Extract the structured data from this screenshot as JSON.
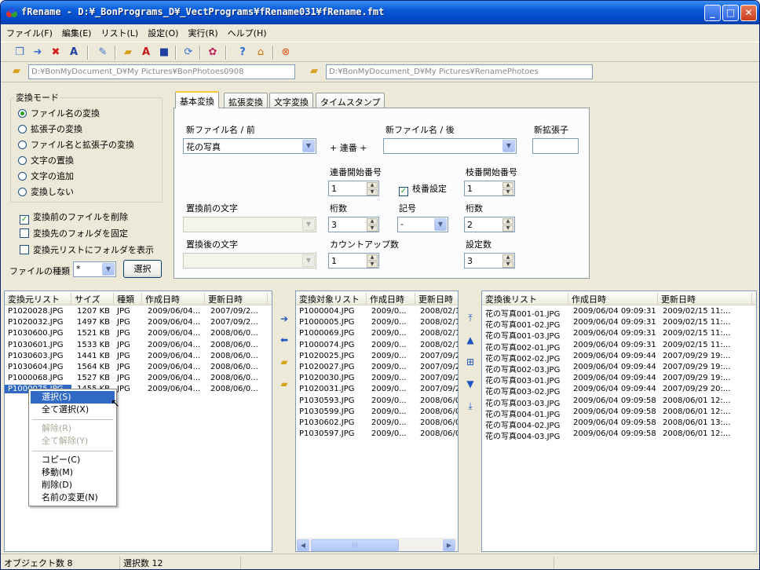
{
  "window": {
    "title": "fRename - D:¥_BonPrograms_D¥_VectPrograms¥fRename031¥fRename.fmt"
  },
  "menu": [
    "ファイル(F)",
    "編集(E)",
    "リスト(L)",
    "設定(O)",
    "実行(R)",
    "ヘルプ(H)"
  ],
  "paths": {
    "source": "D:¥BonMyDocument_D¥My Pictures¥BonPhotoes0908",
    "dest": "D:¥BonMyDocument_D¥My Pictures¥RenamePhotoes"
  },
  "mode": {
    "legend": "変換モード",
    "options": [
      "ファイル名の変換",
      "拡張子の変換",
      "ファイル名と拡張子の変換",
      "文字の置換",
      "文字の追加",
      "変換しない"
    ]
  },
  "checks": [
    "変換前のファイルを削除",
    "変換先のフォルダを固定",
    "変換元リストにフォルダを表示"
  ],
  "filetype": {
    "label": "ファイルの種類",
    "value": "*",
    "button": "選択"
  },
  "tabs": [
    "基本変換",
    "拡張変換",
    "文字変換",
    "タイムスタンプ"
  ],
  "basic": {
    "new_name_before_label": "新ファイル名 / 前",
    "new_name_before_value": "花の写真",
    "plus_seq": "+ 連番 +",
    "new_name_after_label": "新ファイル名 / 後",
    "new_ext_label": "新拡張子",
    "seq_start_label": "連番開始番号",
    "seq_start_value": "1",
    "branch_check_label": "枝番設定",
    "branch_start_label": "枝番開始番号",
    "branch_start_value": "1",
    "replace_before_label": "置換前の文字",
    "digits_label": "桁数",
    "digits_value": "3",
    "symbol_label": "記号",
    "symbol_value": "-",
    "branch_digits_label": "桁数",
    "branch_digits_value": "2",
    "replace_after_label": "置換後の文字",
    "countup_label": "カウントアップ数",
    "countup_value": "1",
    "setcount_label": "設定数",
    "setcount_value": "3"
  },
  "source_list": {
    "headers": [
      "変換元リスト",
      "サイズ",
      "種類",
      "作成日時",
      "更新日時"
    ],
    "rows": [
      [
        "P1020028.JPG",
        "1207 KB",
        "JPG",
        "2009/06/04...",
        "2007/09/2..."
      ],
      [
        "P1020032.JPG",
        "1497 KB",
        "JPG",
        "2009/06/04...",
        "2007/09/2..."
      ],
      [
        "P1030600.JPG",
        "1521 KB",
        "JPG",
        "2009/06/04...",
        "2008/06/0..."
      ],
      [
        "P1030601.JPG",
        "1533 KB",
        "JPG",
        "2009/06/04...",
        "2008/06/0..."
      ],
      [
        "P1030603.JPG",
        "1441 KB",
        "JPG",
        "2009/06/04...",
        "2008/06/0..."
      ],
      [
        "P1030604.JPG",
        "1564 KB",
        "JPG",
        "2009/06/04...",
        "2008/06/0..."
      ],
      [
        "P1000068.JPG",
        "1527 KB",
        "JPG",
        "2009/06/04...",
        "2008/06/0..."
      ],
      [
        "P1000075.JPG",
        "1455 KB",
        "JPG",
        "2009/06/04...",
        "2008/06/0..."
      ]
    ]
  },
  "target_list": {
    "headers": [
      "変換対象リスト",
      "作成日時",
      "更新日時"
    ],
    "rows": [
      [
        "P1000004.JPG",
        "2009/0...",
        "2008/02/1"
      ],
      [
        "P1000005.JPG",
        "2009/0...",
        "2008/02/1"
      ],
      [
        "P1000069.JPG",
        "2009/0...",
        "2008/02/1"
      ],
      [
        "P1000074.JPG",
        "2009/0...",
        "2008/02/1"
      ],
      [
        "P1020025.JPG",
        "2009/0...",
        "2007/09/2"
      ],
      [
        "P1020027.JPG",
        "2009/0...",
        "2007/09/2"
      ],
      [
        "P1020030.JPG",
        "2009/0...",
        "2007/09/2"
      ],
      [
        "P1020031.JPG",
        "2009/0...",
        "2007/09/2"
      ],
      [
        "P1030593.JPG",
        "2009/0...",
        "2008/06/0"
      ],
      [
        "P1030599.JPG",
        "2009/0...",
        "2008/06/0"
      ],
      [
        "P1030602.JPG",
        "2009/0...",
        "2008/06/0"
      ],
      [
        "P1030597.JPG",
        "2009/0...",
        "2008/06/0"
      ]
    ]
  },
  "result_list": {
    "headers": [
      "変換後リスト",
      "作成日時",
      "更新日時"
    ],
    "rows": [
      [
        "花の写真001-01.JPG",
        "2009/06/04 09:09:31",
        "2009/02/15 11:..."
      ],
      [
        "花の写真001-02.JPG",
        "2009/06/04 09:09:31",
        "2009/02/15 11:..."
      ],
      [
        "花の写真001-03.JPG",
        "2009/06/04 09:09:31",
        "2009/02/15 11:..."
      ],
      [
        "花の写真002-01.JPG",
        "2009/06/04 09:09:31",
        "2009/02/15 11:..."
      ],
      [
        "花の写真002-02.JPG",
        "2009/06/04 09:09:44",
        "2007/09/29 19:..."
      ],
      [
        "花の写真002-03.JPG",
        "2009/06/04 09:09:44",
        "2007/09/29 19:..."
      ],
      [
        "花の写真003-01.JPG",
        "2009/06/04 09:09:44",
        "2007/09/29 19:..."
      ],
      [
        "花の写真003-02.JPG",
        "2009/06/04 09:09:44",
        "2007/09/29 20:..."
      ],
      [
        "花の写真003-03.JPG",
        "2009/06/04 09:09:58",
        "2008/06/01 12:..."
      ],
      [
        "花の写真004-01.JPG",
        "2009/06/04 09:09:58",
        "2008/06/01 12:..."
      ],
      [
        "花の写真004-02.JPG",
        "2009/06/04 09:09:58",
        "2008/06/01 13:..."
      ],
      [
        "花の写真004-03.JPG",
        "2009/06/04 09:09:58",
        "2008/06/01 12:..."
      ]
    ]
  },
  "context_menu": {
    "items": [
      "選択(S)",
      "全て選択(X)",
      "解除(R)",
      "全て解除(Y)",
      "コピー(C)",
      "移動(M)",
      "削除(D)",
      "名前の変更(N)"
    ]
  },
  "status": {
    "objects": "オブジェクト数 8",
    "selected": "選択数 12"
  }
}
